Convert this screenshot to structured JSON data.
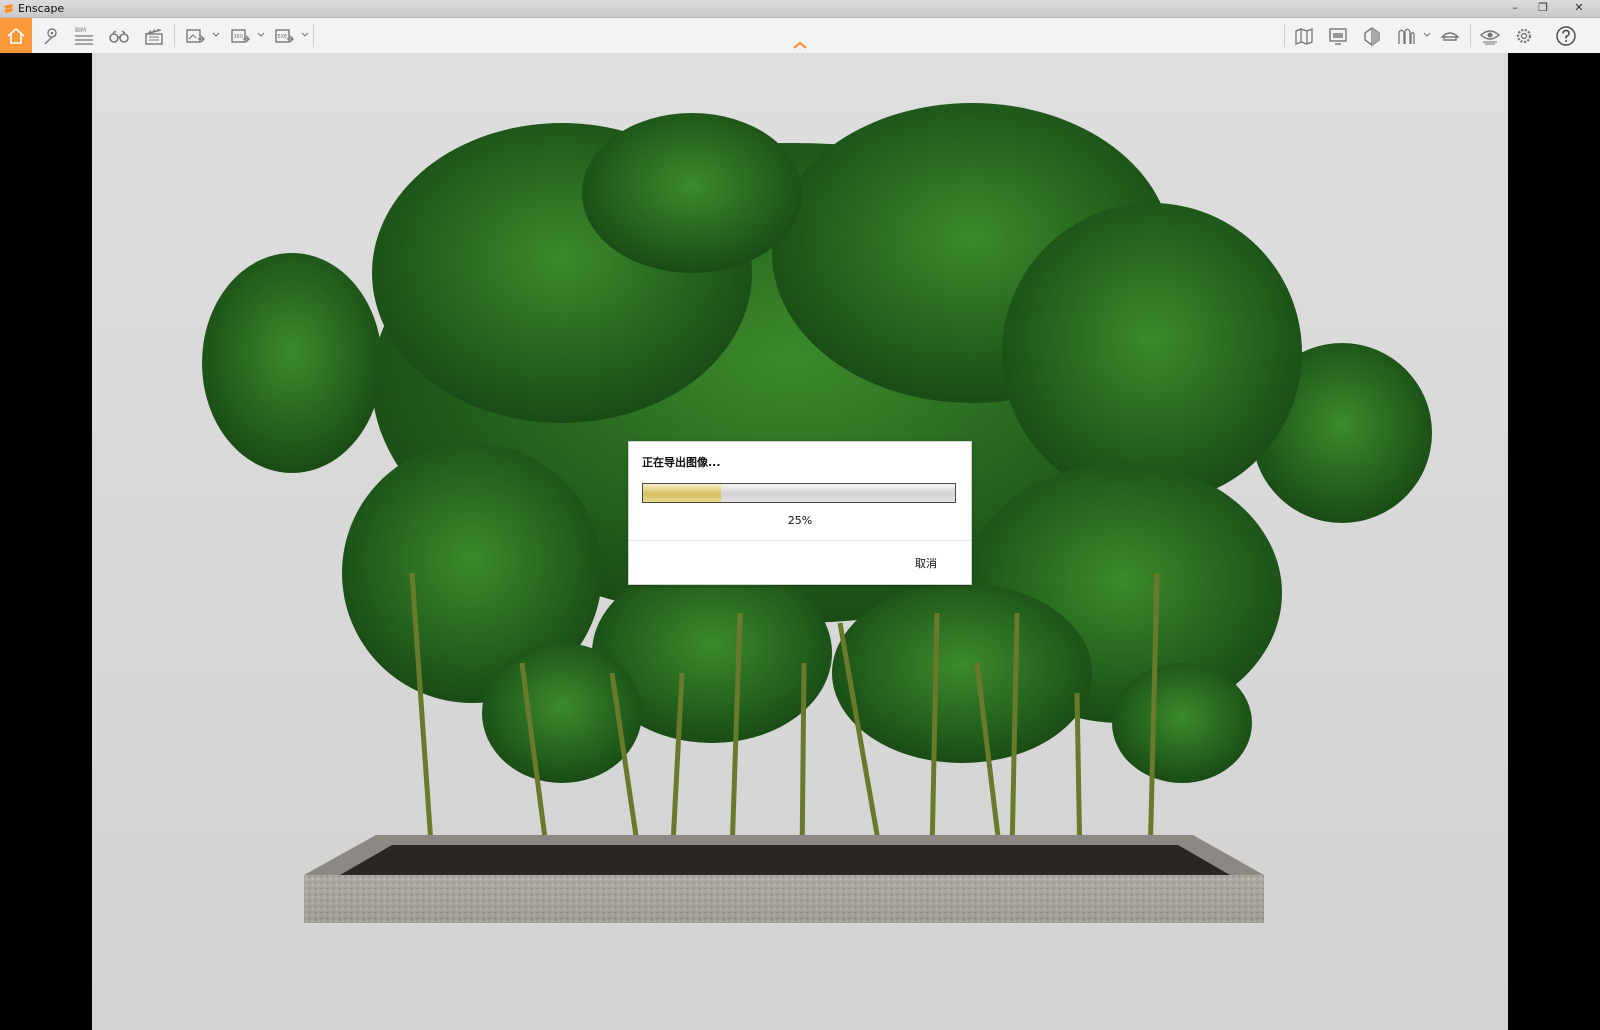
{
  "window": {
    "title": "Enscape",
    "controls": [
      "minimize-icon",
      "restore-icon",
      "close-icon"
    ]
  },
  "toolbar": {
    "left_icons": [
      "home-icon",
      "location-pin-icon",
      "bim-list-icon",
      "binoculars-icon",
      "clapperboard-icon",
      "screenshot-export-icon",
      "export-360-icon",
      "export-exe-icon"
    ],
    "bim_label": "BIM",
    "pano_label": "360",
    "exe_label": "EXE",
    "right_icons": [
      "map-icon",
      "presentation-icon",
      "section-icon",
      "asset-library-icon",
      "hat-icon",
      "visual-settings-icon",
      "settings-gear-icon",
      "help-icon"
    ],
    "accent_color": "#ff9a3c"
  },
  "dialog": {
    "title": "正在导出图像...",
    "progress_percent_text": "25%",
    "progress_value": 0.25,
    "cancel_label": "取消"
  }
}
